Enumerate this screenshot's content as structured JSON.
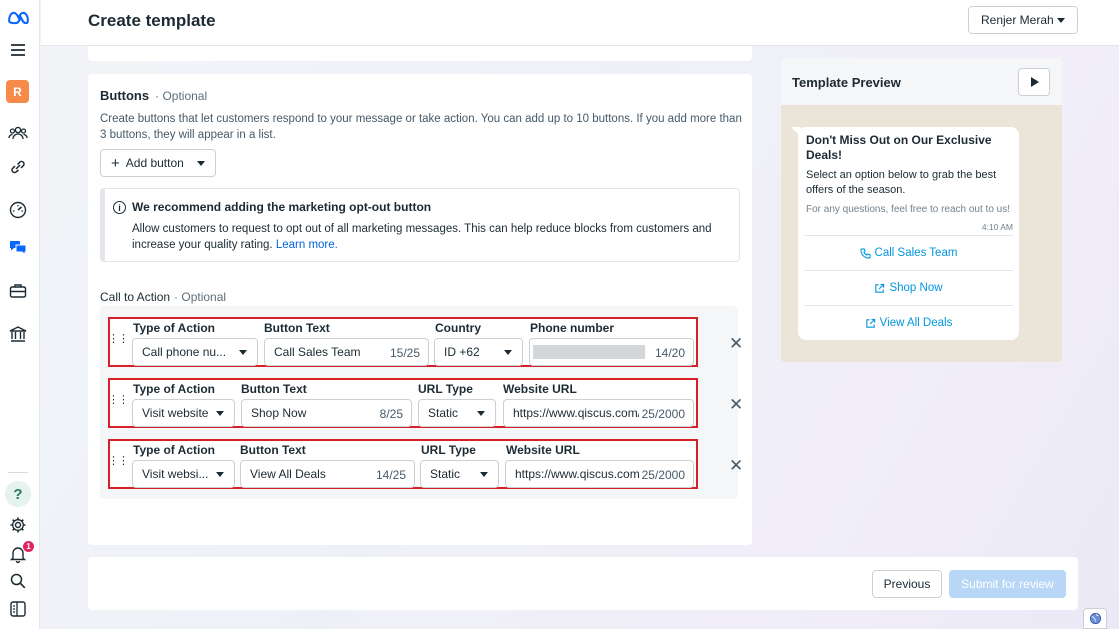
{
  "header": {
    "title": "Create template",
    "account": "Renjer Merah"
  },
  "rail": {
    "avatar_letter": "R",
    "notification_count": "1",
    "help": "?"
  },
  "buttons_section": {
    "title": "Buttons",
    "optional": "· Optional",
    "description": "Create buttons that let customers respond to your message or take action. You can add up to 10 buttons. If you add more than 3 buttons, they will appear in a list.",
    "add_button_label": "Add button"
  },
  "notice": {
    "title": "We recommend adding the marketing opt-out button",
    "body": "Allow customers to request to opt out of all marketing messages. This can help reduce blocks from customers and increase your quality rating.",
    "link": "Learn more."
  },
  "cta": {
    "title": "Call to Action",
    "optional": "· Optional",
    "rows": [
      {
        "label_type": "Type of Action",
        "type": "Call phone nu...",
        "label_text": "Button Text",
        "text": "Call Sales Team",
        "text_count": "15/25",
        "label_third": "Country",
        "third": "ID +62",
        "label_fourth": "Phone number",
        "fourth": "",
        "fourth_count": "14/20"
      },
      {
        "label_type": "Type of Action",
        "type": "Visit website",
        "label_text": "Button Text",
        "text": "Shop Now",
        "text_count": "8/25",
        "label_third": "URL Type",
        "third": "Static",
        "label_fourth": "Website URL",
        "fourth": "https://www.qiscus.com/",
        "fourth_count": "25/2000"
      },
      {
        "label_type": "Type of Action",
        "type": "Visit websi...",
        "label_text": "Button Text",
        "text": "View All Deals",
        "text_count": "14/25",
        "label_third": "URL Type",
        "third": "Static",
        "label_fourth": "Website URL",
        "fourth": "https://www.qiscus.com",
        "fourth_count": "25/2000"
      }
    ]
  },
  "footer": {
    "previous": "Previous",
    "submit": "Submit for review"
  },
  "preview": {
    "title": "Template Preview",
    "message_title": "Don't Miss Out on Our Exclusive Deals!",
    "message_body": "Select an option below to grab the best offers of the season.",
    "message_footer": "For any questions, feel free to reach out to us!",
    "time": "4:10 AM",
    "buttons": [
      "Call Sales Team",
      "Shop Now",
      "View All Deals"
    ]
  },
  "colors": {
    "accent": "#0064e0",
    "highlight_border": "#d6202a",
    "preview_link": "#0096de",
    "submit_disabled": "#b8d6f6"
  },
  "icons": [
    "meta-logo-icon",
    "menu-icon",
    "people-icon",
    "link-icon",
    "speedometer-icon",
    "chat-icon",
    "briefcase-icon",
    "bank-icon",
    "gear-icon",
    "bell-icon",
    "search-icon",
    "panel-icon",
    "info-icon",
    "close-icon",
    "drag-handle-icon",
    "play-icon",
    "phone-icon",
    "external-link-icon",
    "globe-icon"
  ]
}
